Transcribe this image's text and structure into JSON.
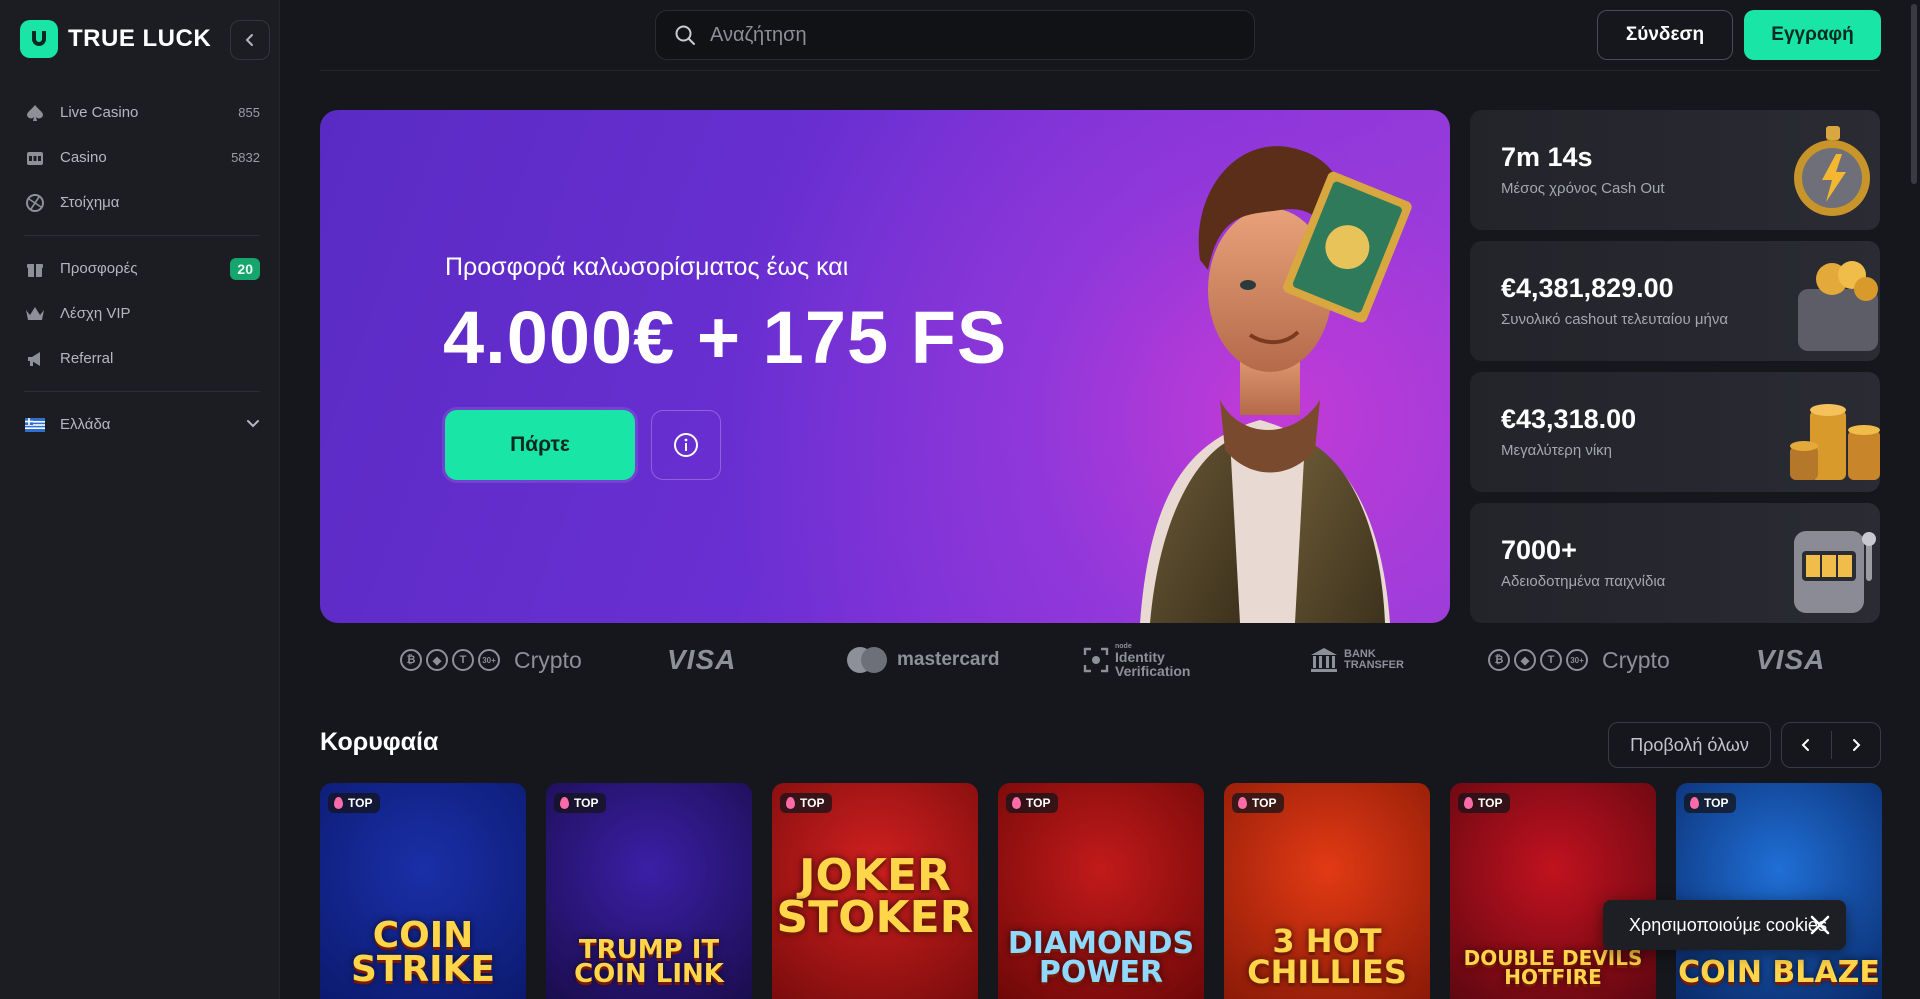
{
  "brand": {
    "name": "TRUE LUCK",
    "accent": "#19e6a6"
  },
  "sidebar": {
    "items": [
      {
        "label": "Live Casino",
        "count": "855",
        "icon": "spade-icon"
      },
      {
        "label": "Casino",
        "count": "5832",
        "icon": "slot-machine-icon"
      },
      {
        "label": "Στοίχημα",
        "count": "",
        "icon": "ball-icon"
      },
      {
        "label": "Προσφορές",
        "badge": "20",
        "icon": "gift-icon"
      },
      {
        "label": "Λέσχη VIP",
        "count": "",
        "icon": "crown-icon"
      },
      {
        "label": "Referral",
        "count": "",
        "icon": "megaphone-icon"
      }
    ],
    "language": {
      "label": "Ελλάδα",
      "icon": "greek-flag-icon"
    }
  },
  "header": {
    "search_placeholder": "Αναζήτηση",
    "login_label": "Σύνδεση",
    "register_label": "Εγγραφή"
  },
  "hero": {
    "subtitle": "Προσφορά καλωσορίσματος έως και",
    "title": "4.000€ + 175 FS",
    "cta_label": "Πάρτε"
  },
  "stats": [
    {
      "value": "7m 14s",
      "label": "Μέσος χρόνος Cash Out",
      "icon": "stopwatch-icon"
    },
    {
      "value": "€4,381,829.00",
      "label": "Συνολικό cashout τελευταίου μήνα",
      "icon": "wallet-coins-icon"
    },
    {
      "value": "€43,318.00",
      "label": "Μεγαλύτερη νίκη",
      "icon": "coin-stack-icon"
    },
    {
      "value": "7000+",
      "label": "Αδειοδοτημένα παιχνίδια",
      "icon": "slot-machine-icon"
    }
  ],
  "payments": {
    "crypto_label": "Crypto",
    "crypto_more": "30+",
    "visa_label": "VISA",
    "mastercard_label": "mastercard",
    "identity_small": "node",
    "identity_label_1": "Identity",
    "identity_label_2": "Verification",
    "bank_label_1": "BANK",
    "bank_label_2": "TRANSFER"
  },
  "top_section": {
    "title": "Κορυφαία",
    "view_all_label": "Προβολή όλων",
    "badge_label": "TOP",
    "games": [
      {
        "title_1": "COIN",
        "title_2": "STRIKE",
        "colors": [
          "#1a2fa8",
          "#0b1a6e"
        ]
      },
      {
        "title_1": "TRUMP IT",
        "title_2": "COIN LINK",
        "colors": [
          "#3b1fa6",
          "#1a0d4d"
        ]
      },
      {
        "title_1": "JOKER",
        "title_2": "STOKER",
        "colors": [
          "#d22020",
          "#7a0c0c"
        ]
      },
      {
        "title_1": "DIAMONDS",
        "title_2": "POWER",
        "colors": [
          "#c21a1a",
          "#6e0808"
        ]
      },
      {
        "title_1": "3 HOT",
        "title_2": "CHILLIES",
        "colors": [
          "#e23a14",
          "#8a1a07"
        ]
      },
      {
        "title_1": "DOUBLE DEVILS",
        "title_2": "HOTFIRE",
        "colors": [
          "#c1121f",
          "#5e0710"
        ]
      },
      {
        "title_1": "",
        "title_2": "COIN BLAZE",
        "colors": [
          "#1f6fd6",
          "#0a2a6a"
        ]
      }
    ]
  },
  "cookie": {
    "text": "Χρησιμοποιούμε cookies"
  }
}
